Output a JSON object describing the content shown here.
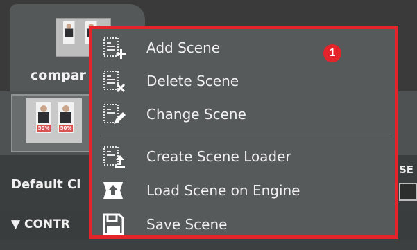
{
  "tab": {
    "label": "compar"
  },
  "thumb": {
    "badge_a": "50%",
    "badge_b": "50%"
  },
  "default": {
    "label": "Default Cl",
    "reset_label": "SE"
  },
  "controls": {
    "label": "▼ CONTR"
  },
  "menu": {
    "items": [
      {
        "label": "Add Scene",
        "icon": "add-scene-icon"
      },
      {
        "label": "Delete Scene",
        "icon": "delete-scene-icon"
      },
      {
        "label": "Change Scene",
        "icon": "change-scene-icon"
      },
      {
        "label": "Create Scene Loader",
        "icon": "create-scene-loader-icon"
      },
      {
        "label": "Load Scene on Engine",
        "icon": "load-scene-icon"
      },
      {
        "label": "Save Scene",
        "icon": "save-scene-icon"
      }
    ]
  },
  "callout": {
    "number": "1"
  },
  "colors": {
    "highlight": "#e4232a",
    "menu_bg": "#575a5b"
  }
}
